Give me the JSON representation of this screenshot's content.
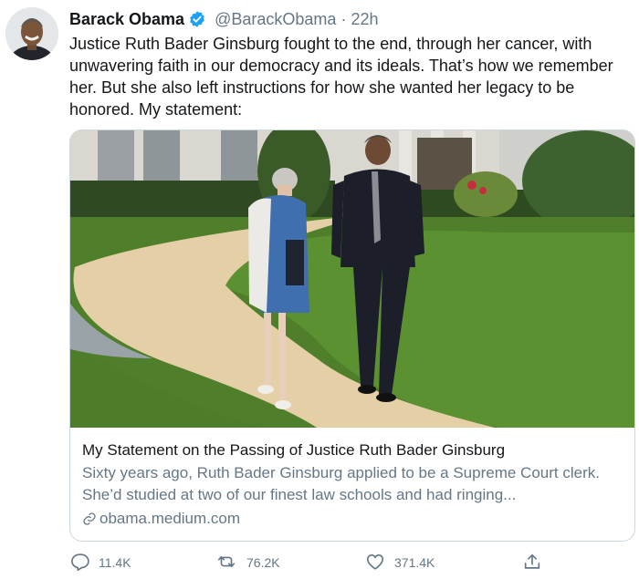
{
  "tweet": {
    "display_name": "Barack Obama",
    "handle": "@BarackObama",
    "separator": "·",
    "time": "22h",
    "text": "Justice Ruth Bader Ginsburg fought to the end, through her cancer, with unwavering faith in our democracy and its ideals. That’s how we remember her. But she also left instructions for how she wanted her legacy to be honored. My statement:"
  },
  "card": {
    "title": "My Statement on the Passing of Justice Ruth Bader Ginsburg",
    "description": "Sixty years ago, Ruth Bader Ginsburg applied to be a Supreme Court clerk. She’d studied at two of our finest law schools and had ringing...",
    "link": "obama.medium.com"
  },
  "actions": {
    "replies": "11.4K",
    "retweets": "76.2K",
    "likes": "371.4K"
  },
  "colors": {
    "text": "#14171a",
    "secondary": "#657786",
    "verified": "#1da1f2",
    "border": "#ccd6dd"
  },
  "icons": [
    "verified-badge-icon",
    "link-icon",
    "reply-icon",
    "retweet-icon",
    "like-icon",
    "share-icon"
  ]
}
